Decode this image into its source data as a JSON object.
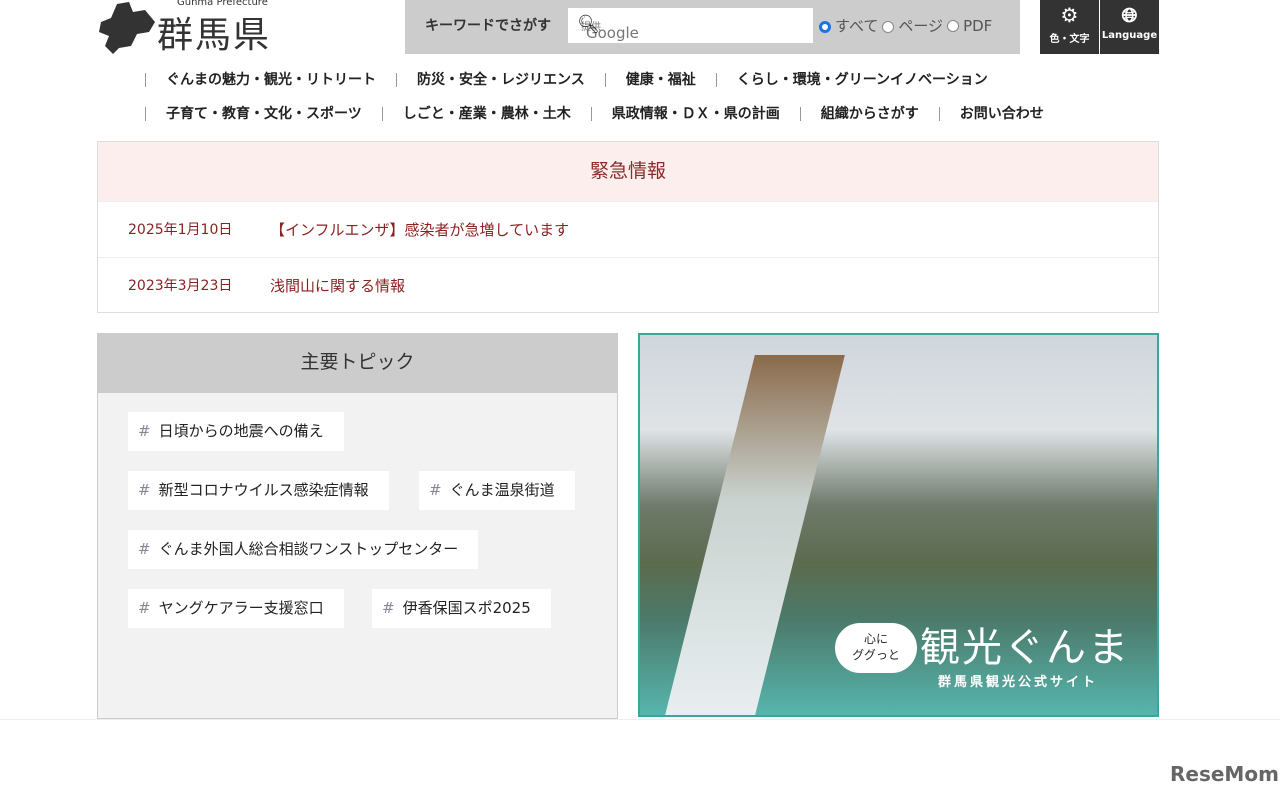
{
  "header": {
    "logo_sub": "Gunma Prefecture",
    "logo_name": "群馬県"
  },
  "search": {
    "label": "キーワードでさがす",
    "placeholder": "Google",
    "provided": "提供",
    "options": [
      "すべて",
      "ページ",
      "PDF"
    ],
    "selected": "すべて"
  },
  "tools": {
    "color_text": "色・文字",
    "language": "Language"
  },
  "nav": {
    "row1": [
      "ぐんまの魅力・観光・リトリート",
      "防災・安全・レジリエンス",
      "健康・福祉",
      "くらし・環境・グリーンイノベーション"
    ],
    "row2": [
      "子育て・教育・文化・スポーツ",
      "しごと・産業・農林・土木",
      "県政情報・ＤＸ・県の計画",
      "組織からさがす",
      "お問い合わせ"
    ]
  },
  "emergency": {
    "title": "緊急情報",
    "items": [
      {
        "date": "2025年1月10日",
        "text": "【インフルエンザ】感染者が急増しています"
      },
      {
        "date": "2023年3月23日",
        "text": "浅間山に関する情報"
      }
    ]
  },
  "topics": {
    "title": "主要トピック",
    "tags": [
      "日頃からの地震への備え",
      "新型コロナウイルス感染症情報",
      "ぐんま温泉街道",
      "ぐんま外国人総合相談ワンストップセンター",
      "ヤングケアラー支援窓口",
      "伊香保国スポ2025"
    ]
  },
  "banner": {
    "bubble1": "心に",
    "bubble2": "ググっと",
    "title": "観光ぐんま",
    "subtitle": "群馬県観光公式サイト"
  },
  "watermark": "ReseMom"
}
